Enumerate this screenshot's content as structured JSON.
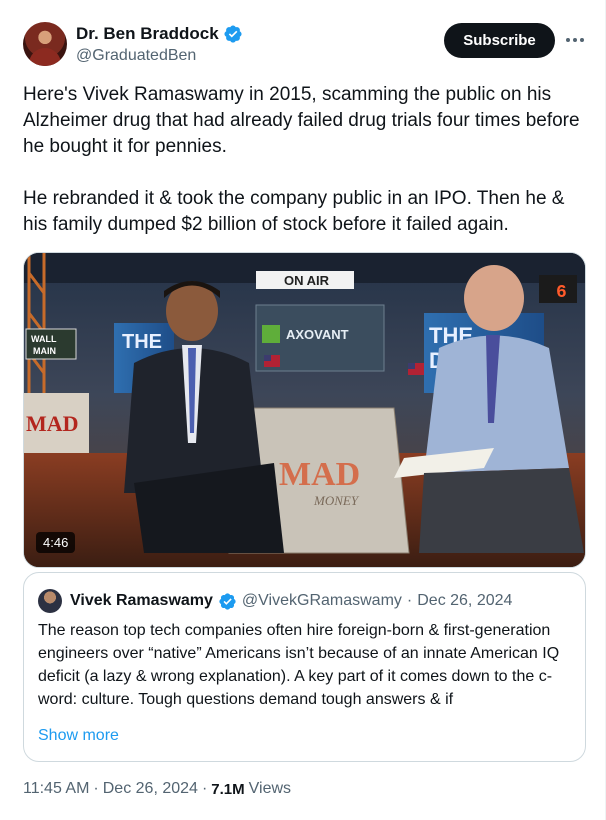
{
  "author": {
    "display_name": "Dr. Ben Braddock",
    "handle": "@GraduatedBen",
    "verified_icon": "verified-badge-icon"
  },
  "actions": {
    "subscribe_label": "Subscribe",
    "more_icon": "more-options-icon"
  },
  "tweet": {
    "paragraphs": [
      "Here's Vivek Ramaswamy in 2015, scamming the public on his Alzheimer drug that had already failed drug trials four times before he bought it for pennies.",
      "He rebranded it & took the company public in an IPO. Then he & his family dumped $2 billion of stock before it failed again."
    ]
  },
  "media": {
    "video_duration": "4:46",
    "on_air_sign": "ON AIR",
    "logo_text": "AXOVANT",
    "desk_text": "MAD",
    "desk_subtext": "MONEY",
    "street_sign_line1": "WALL",
    "street_sign_line2": "MAIN",
    "screen_text_left": "THE",
    "screen_text_right": "THE",
    "screen_text_right2": "DE",
    "digit": "6"
  },
  "quote": {
    "display_name": "Vivek Ramaswamy",
    "handle": "@VivekGRamaswamy",
    "separator": "·",
    "date": "Dec 26, 2024",
    "text": "The reason top tech companies often hire foreign-born & first-generation engineers over “native” Americans isn’t because of an innate American IQ deficit (a lazy & wrong explanation). A key part of it comes down to the c-word: culture. Tough questions demand tough answers & if",
    "show_more": "Show more"
  },
  "meta": {
    "time": "11:45 AM",
    "separator": "·",
    "date": "Dec 26, 2024",
    "separator2": "·",
    "views_count": "7.1M",
    "views_label": "Views"
  },
  "colors": {
    "accent": "#1d9bf0",
    "text_primary": "#0f1419",
    "text_secondary": "#536471",
    "border": "#cfd9de"
  }
}
